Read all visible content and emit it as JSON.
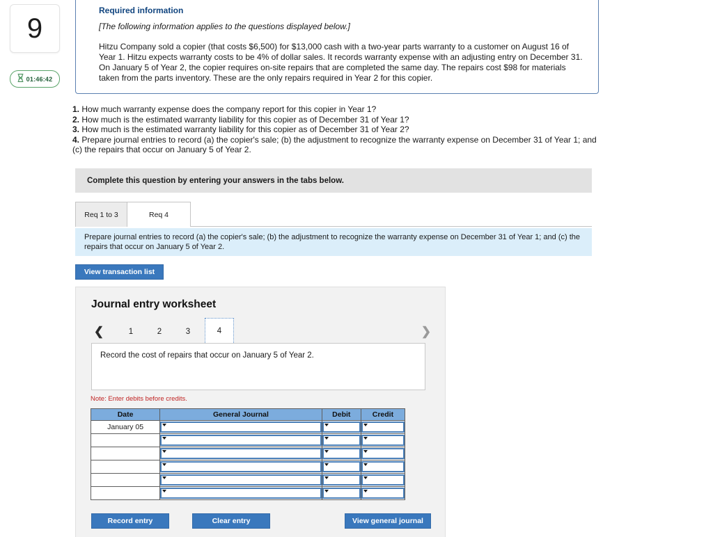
{
  "left_rail": {
    "question_number": "9",
    "timer_icon": "hourglass-icon",
    "timer_value": "01:46:42"
  },
  "required_information": {
    "heading": "Required information",
    "applies_note": "[The following information applies to the questions displayed below.]",
    "body": "Hitzu Company sold a copier (that costs $6,500) for $13,000 cash with a two-year parts warranty to a customer on August 16 of Year 1. Hitzu expects warranty costs to be 4% of dollar sales. It records warranty expense with an adjusting entry on December 31. On January 5 of Year 2, the copier requires on-site repairs that are completed the same day. The repairs cost $98 for materials taken from the parts inventory. These are the only repairs required in Year 2 for this copier."
  },
  "questions": [
    {
      "num": "1.",
      "text": "How much warranty expense does the company report for this copier in Year 1?"
    },
    {
      "num": "2.",
      "text": "How much is the estimated warranty liability for this copier as of December 31 of Year 1?"
    },
    {
      "num": "3.",
      "text": "How much is the estimated warranty liability for this copier as of December 31 of Year 2?"
    },
    {
      "num": "4.",
      "text": "Prepare journal entries to record (a) the copier's sale; (b) the adjustment to recognize the warranty expense on December 31 of Year 1; and (c) the repairs that occur on January 5 of Year 2."
    }
  ],
  "complete_banner": "Complete this question by entering your answers in the tabs below.",
  "tabs": [
    {
      "label": "Req 1 to 3",
      "active": false
    },
    {
      "label": "Req 4",
      "active": true
    }
  ],
  "blue_strip": "Prepare journal entries to record (a) the copier's sale; (b) the adjustment to recognize the warranty expense on December 31 of Year 1; and (c) the repairs that occur on January 5 of Year 2.",
  "view_transaction_list_label": "View transaction list",
  "worksheet": {
    "title": "Journal entry worksheet",
    "pager": {
      "prev_icon": "chevron-left-icon",
      "next_icon": "chevron-right-icon",
      "pages": [
        "1",
        "2",
        "3",
        "4"
      ],
      "active_page": "4"
    },
    "description": "Record the cost of repairs that occur on January 5 of Year 2.",
    "note": "Note: Enter debits before credits.",
    "table": {
      "columns": [
        "Date",
        "General Journal",
        "Debit",
        "Credit"
      ],
      "rows": [
        {
          "date": "January 05",
          "general_journal": "",
          "debit": "",
          "credit": ""
        },
        {
          "date": "",
          "general_journal": "",
          "debit": "",
          "credit": ""
        },
        {
          "date": "",
          "general_journal": "",
          "debit": "",
          "credit": ""
        },
        {
          "date": "",
          "general_journal": "",
          "debit": "",
          "credit": ""
        },
        {
          "date": "",
          "general_journal": "",
          "debit": "",
          "credit": ""
        },
        {
          "date": "",
          "general_journal": "",
          "debit": "",
          "credit": ""
        }
      ]
    },
    "buttons": {
      "record_entry": "Record entry",
      "clear_entry": "Clear entry",
      "view_general_journal": "View general journal"
    }
  },
  "colors": {
    "primary_blue": "#3a78bd",
    "heading_blue": "#11457f",
    "table_header_blue": "#7cacdd",
    "strip_blue": "#dbeefa",
    "note_red": "#c02423",
    "timer_green": "#5aa469",
    "banner_grey": "#e2e2e2"
  }
}
